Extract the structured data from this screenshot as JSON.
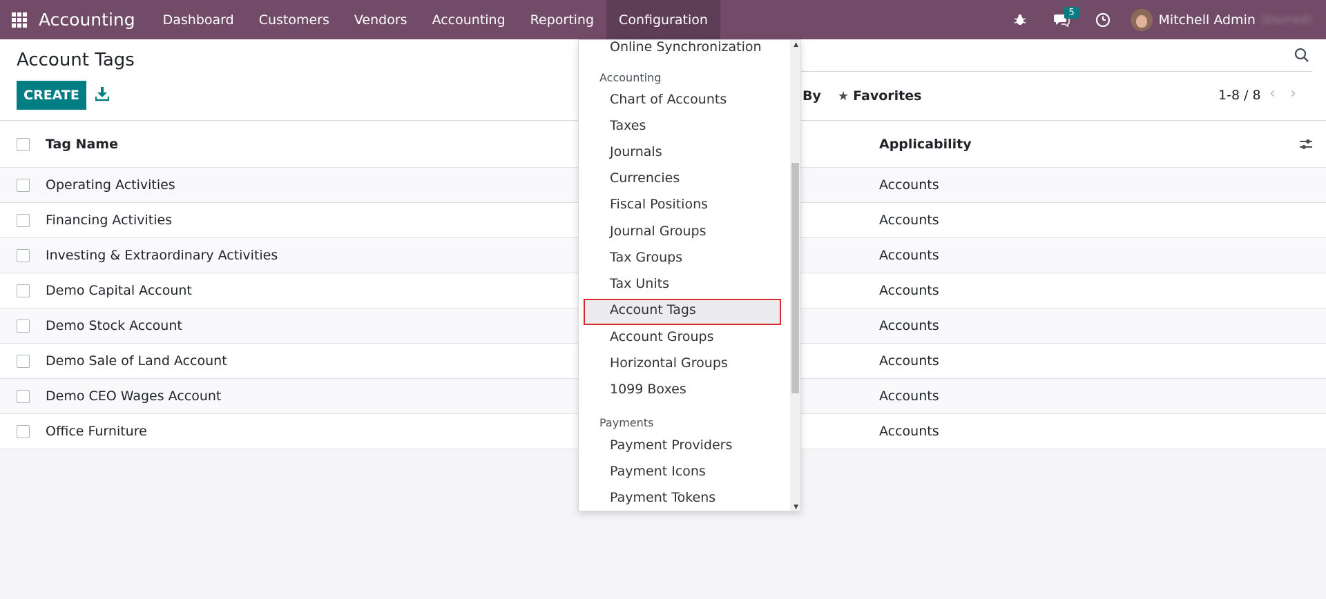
{
  "navbar": {
    "brand": "Accounting",
    "menu": [
      "Dashboard",
      "Customers",
      "Vendors",
      "Accounting",
      "Reporting",
      "Configuration"
    ],
    "messages_count": "5",
    "user_name": "Mitchell Admin",
    "db_name": "(blurred)"
  },
  "control_panel": {
    "title": "Account Tags",
    "create_label": "CREATE",
    "groupby_label": "By",
    "favorites_label": "Favorites",
    "pager": "1-8 / 8"
  },
  "list": {
    "columns": [
      "Tag Name",
      "Applicability"
    ],
    "rows": [
      {
        "name": "Operating Activities",
        "applicability": "Accounts"
      },
      {
        "name": "Financing Activities",
        "applicability": "Accounts"
      },
      {
        "name": "Investing & Extraordinary Activities",
        "applicability": "Accounts"
      },
      {
        "name": "Demo Capital Account",
        "applicability": "Accounts"
      },
      {
        "name": "Demo Stock Account",
        "applicability": "Accounts"
      },
      {
        "name": "Demo Sale of Land Account",
        "applicability": "Accounts"
      },
      {
        "name": "Demo CEO Wages Account",
        "applicability": "Accounts"
      },
      {
        "name": "Office Furniture",
        "applicability": "Accounts"
      }
    ]
  },
  "dropdown": {
    "top_item": "Online Synchronization",
    "sections": [
      {
        "title": "Accounting",
        "items": [
          "Chart of Accounts",
          "Taxes",
          "Journals",
          "Currencies",
          "Fiscal Positions",
          "Journal Groups",
          "Tax Groups",
          "Tax Units",
          "Account Tags",
          "Account Groups",
          "Horizontal Groups",
          "1099 Boxes"
        ]
      },
      {
        "title": "Payments",
        "items": [
          "Payment Providers",
          "Payment Icons",
          "Payment Tokens"
        ]
      }
    ],
    "highlighted_item": "Account Tags"
  },
  "colors": {
    "navbar": "#714b67",
    "primary": "#017e84",
    "highlight_border": "#d42a2a"
  }
}
